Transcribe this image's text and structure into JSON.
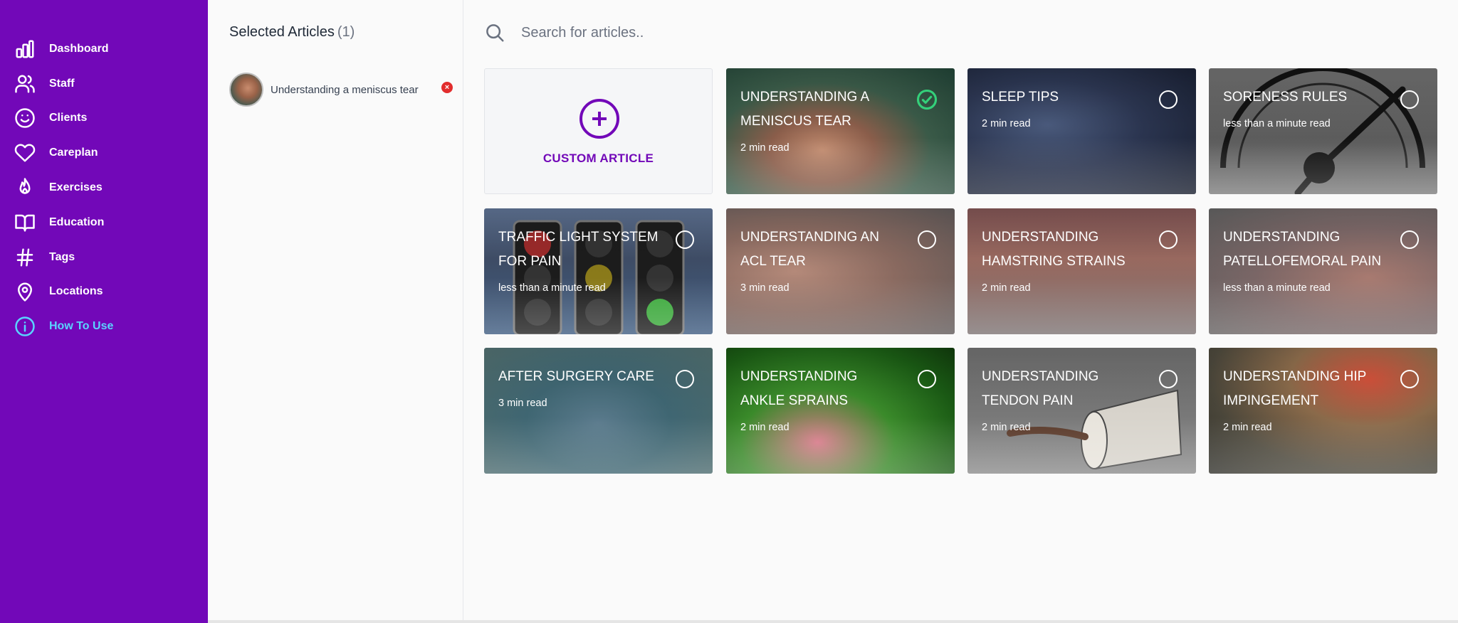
{
  "sidebar": {
    "items": [
      {
        "label": "Dashboard",
        "icon": "bar-chart-icon"
      },
      {
        "label": "Staff",
        "icon": "users-icon"
      },
      {
        "label": "Clients",
        "icon": "smile-icon"
      },
      {
        "label": "Careplan",
        "icon": "heart-icon"
      },
      {
        "label": "Exercises",
        "icon": "fire-icon"
      },
      {
        "label": "Education",
        "icon": "book-icon"
      },
      {
        "label": "Tags",
        "icon": "hashtag-icon"
      },
      {
        "label": "Locations",
        "icon": "location-pin-icon"
      },
      {
        "label": "How To Use",
        "icon": "info-icon",
        "active": true
      }
    ],
    "background": "#7208b8",
    "active_color": "#5ad4ff"
  },
  "selected": {
    "title": "Selected Articles",
    "count": "(1)",
    "items": [
      {
        "label": "Understanding a meniscus tear"
      }
    ],
    "remove_symbol": "×"
  },
  "search": {
    "placeholder": "Search for articles.."
  },
  "custom_article": {
    "label": "CUSTOM ARTICLE"
  },
  "articles": [
    {
      "title": "UNDERSTANDING A MENISCUS TEAR",
      "meta": "2 min read",
      "selected": true
    },
    {
      "title": "SLEEP TIPS",
      "meta": "2 min read",
      "selected": false
    },
    {
      "title": "SORENESS RULES",
      "meta": "less than a minute read",
      "selected": false
    },
    {
      "title": "TRAFFIC LIGHT SYSTEM FOR PAIN",
      "meta": "less than a minute read",
      "selected": false
    },
    {
      "title": "UNDERSTANDING AN ACL TEAR",
      "meta": "3 min read",
      "selected": false
    },
    {
      "title": "UNDERSTANDING HAMSTRING STRAINS",
      "meta": "2 min read",
      "selected": false
    },
    {
      "title": "UNDERSTANDING PATELLOFEMORAL PAIN",
      "meta": "less than a minute read",
      "selected": false
    },
    {
      "title": "AFTER SURGERY CARE",
      "meta": "3 min read",
      "selected": false
    },
    {
      "title": "UNDERSTANDING ANKLE SPRAINS",
      "meta": "2 min read",
      "selected": false
    },
    {
      "title": "UNDERSTANDING TENDON PAIN",
      "meta": "2 min read",
      "selected": false
    },
    {
      "title": "UNDERSTANDING HIP IMPINGEMENT",
      "meta": "2 min read",
      "selected": false
    }
  ],
  "colors": {
    "accent": "#7208b8",
    "check": "#34d07a",
    "remove": "#e22d2d"
  }
}
